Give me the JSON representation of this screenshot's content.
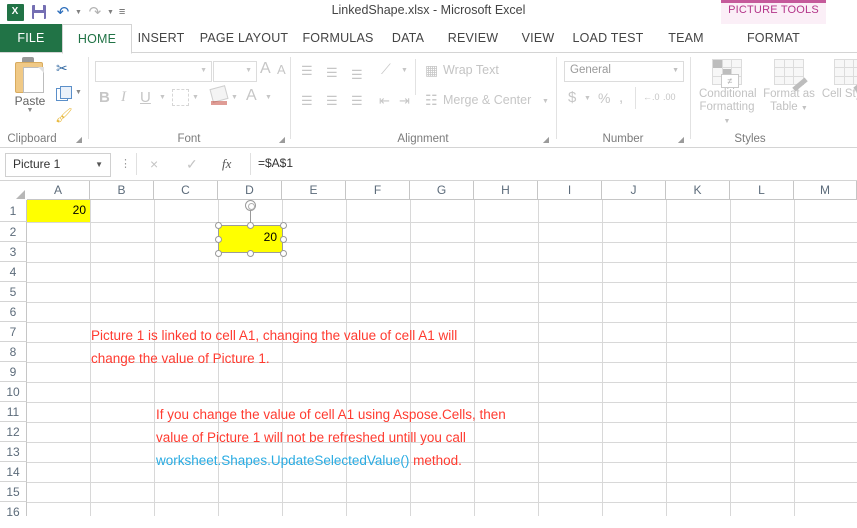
{
  "window": {
    "document_title": "LinkedShape.xlsx - Microsoft Excel"
  },
  "quick_access_toolbar": {
    "items": [
      {
        "name": "excel-logo",
        "label": "X"
      },
      {
        "name": "save-icon",
        "label": "Save"
      },
      {
        "name": "undo-icon",
        "label": "Undo"
      },
      {
        "name": "redo-icon",
        "label": "Redo"
      },
      {
        "name": "customize-qat",
        "label": "Customize Quick Access Toolbar"
      }
    ]
  },
  "contextual_tools": {
    "label": "PICTURE TOOLS",
    "accent_color": "#c55a9b",
    "background_color": "#fbeff7"
  },
  "ribbon": {
    "tabs": [
      {
        "label": "FILE",
        "active": false,
        "style": "file"
      },
      {
        "label": "HOME",
        "active": true,
        "style": "normal"
      },
      {
        "label": "INSERT",
        "active": false,
        "style": "normal"
      },
      {
        "label": "PAGE LAYOUT",
        "active": false,
        "style": "normal"
      },
      {
        "label": "FORMULAS",
        "active": false,
        "style": "normal"
      },
      {
        "label": "DATA",
        "active": false,
        "style": "normal"
      },
      {
        "label": "REVIEW",
        "active": false,
        "style": "normal"
      },
      {
        "label": "VIEW",
        "active": false,
        "style": "normal"
      },
      {
        "label": "LOAD TEST",
        "active": false,
        "style": "normal"
      },
      {
        "label": "TEAM",
        "active": false,
        "style": "normal"
      },
      {
        "label": "FORMAT",
        "active": false,
        "style": "contextual"
      }
    ],
    "groups": {
      "clipboard": {
        "label": "Clipboard",
        "paste_label": "Paste",
        "cut_label": "Cut",
        "copy_label": "Copy",
        "format_painter_label": "Format Painter"
      },
      "font": {
        "label": "Font",
        "font_name": "",
        "font_size": "",
        "grow_font": "A",
        "shrink_font": "A",
        "bold": "B",
        "italic": "I",
        "underline": "U",
        "borders_label": "Borders",
        "fill_color": "A",
        "font_color": "A"
      },
      "alignment": {
        "label": "Alignment",
        "wrap_text": "Wrap Text",
        "merge_center": "Merge & Center"
      },
      "number": {
        "label": "Number",
        "format": "General",
        "currency": "$",
        "percent": "%",
        "comma": ",",
        "increase_decimal": ".00",
        "decrease_decimal": ".00"
      },
      "styles": {
        "label": "Styles",
        "conditional_formatting": "Conditional Formatting",
        "format_as_table": "Format as Table",
        "cell_styles": "Cell Styles"
      }
    }
  },
  "formula_bar": {
    "name_box_value": "Picture 1",
    "cancel_icon": "×",
    "enter_icon": "✓",
    "function_icon": "fx",
    "formula_value": "=$A$1"
  },
  "sheet": {
    "columns": [
      "A",
      "B",
      "C",
      "D",
      "E",
      "F",
      "G",
      "H",
      "I",
      "J",
      "K",
      "L",
      "M"
    ],
    "rows": [
      "1",
      "2",
      "3",
      "4",
      "5",
      "6",
      "7",
      "8",
      "9",
      "10",
      "11",
      "12",
      "13",
      "14",
      "15",
      "16"
    ],
    "cells": [
      {
        "ref": "A1",
        "value": "20",
        "fill": "#ffff00",
        "align": "right"
      }
    ],
    "linked_shape": {
      "name": "Picture 1",
      "value": "20",
      "fill": "#ffff00",
      "border": "#9c9c9c",
      "selected": true,
      "anchor_cell": "D3"
    },
    "annotations": [
      {
        "id": "note-1",
        "color": "#ff3b30",
        "lines": [
          [
            {
              "text": "Picture 1 is linked to cell A1, changing the value of cell A1 will",
              "style": "plain"
            }
          ],
          [
            {
              "text": "change the value of Picture 1.",
              "style": "plain"
            }
          ]
        ]
      },
      {
        "id": "note-2",
        "color": "#ff3b30",
        "lines": [
          [
            {
              "text": "If you change the value of cell A1 using Aspose.Cells, then",
              "style": "plain"
            }
          ],
          [
            {
              "text": "value of Picture 1 will not be refreshed untill you call",
              "style": "plain"
            }
          ],
          [
            {
              "text": "worksheet.Shapes.UpdateSelectedValue()",
              "style": "code"
            },
            {
              "text": " method.",
              "style": "plain"
            }
          ]
        ]
      }
    ]
  }
}
